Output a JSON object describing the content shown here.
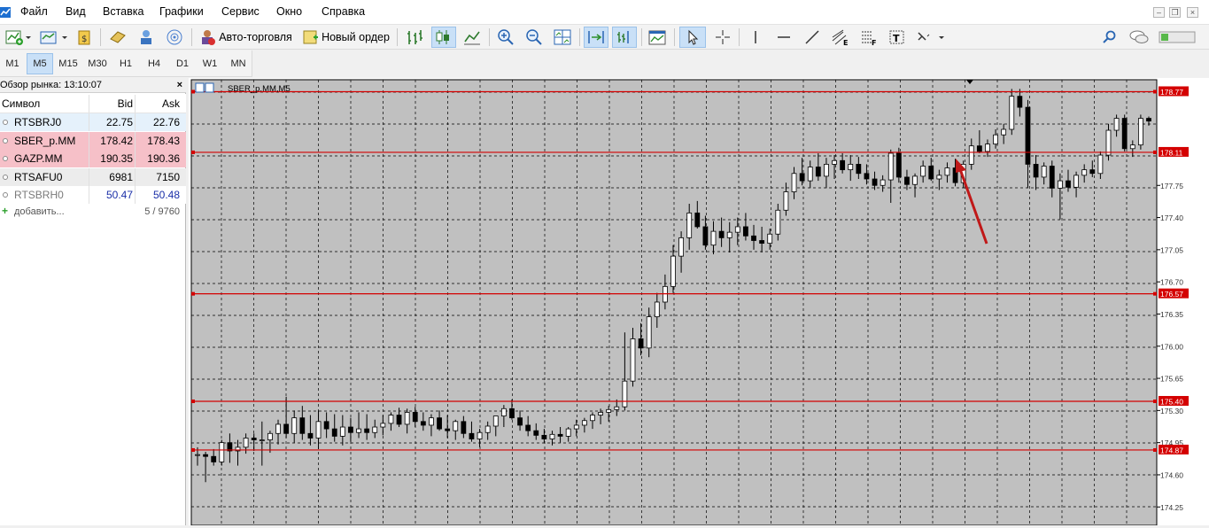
{
  "menu": [
    "Файл",
    "Вид",
    "Вставка",
    "Графики",
    "Сервис",
    "Окно",
    "Справка"
  ],
  "toolbar": {
    "auto_trading_label": "Авто-торговля",
    "new_order_label": "Новый ордер"
  },
  "timeframes": [
    "M1",
    "M5",
    "M15",
    "M30",
    "H1",
    "H4",
    "D1",
    "W1",
    "MN"
  ],
  "active_timeframe": "M5",
  "market_watch": {
    "title": "Обзор рынка: 13:10:07",
    "close_label": "×",
    "headers": {
      "symbol": "Символ",
      "bid": "Bid",
      "ask": "Ask"
    },
    "rows": [
      {
        "symbol": "RTSBRJ0",
        "bid": "22.75",
        "ask": "22.76",
        "bg": "#e5f1fb",
        "color": "#000000"
      },
      {
        "symbol": "SBER_p.MM",
        "bid": "178.42",
        "ask": "178.43",
        "bg": "#f6c0c8",
        "color": "#000000"
      },
      {
        "symbol": "GAZP.MM",
        "bid": "190.35",
        "ask": "190.36",
        "bg": "#f6c0c8",
        "color": "#000000"
      },
      {
        "symbol": "RTSAFU0",
        "bid": "6981",
        "ask": "7150",
        "bg": "#ececec",
        "color": "#000000"
      },
      {
        "symbol": "RTSBRH0",
        "bid": "50.47",
        "ask": "50.48",
        "bg": "#ffffff",
        "color": "#7a7a7a",
        "value_color": "#1a2fa8"
      }
    ],
    "add_label": "добавить...",
    "count_label": "5 / 9760"
  },
  "chart": {
    "title": "SBER_p.MM,M5",
    "y_ticks": [
      "178.77",
      "178.11",
      "177.75",
      "177.40",
      "177.05",
      "176.70",
      "176.57",
      "176.35",
      "176.00",
      "175.65",
      "175.40",
      "175.30",
      "174.95",
      "174.87",
      "174.60",
      "174.25"
    ],
    "highlighted_levels": [
      "178.77",
      "178.11",
      "176.57",
      "175.40",
      "174.87"
    ],
    "level_line_color": "#d40000",
    "background": "#c0c0c0"
  },
  "chart_data": {
    "type": "candlestick",
    "title": "SBER_p.MM,M5",
    "ylim": [
      174.05,
      178.9
    ],
    "horizontal_levels": [
      178.77,
      178.11,
      176.57,
      175.4,
      174.87
    ],
    "candles": [
      [
        174.82,
        174.9,
        174.7,
        174.82
      ],
      [
        174.82,
        174.85,
        174.52,
        174.8
      ],
      [
        174.8,
        174.88,
        174.7,
        174.74
      ],
      [
        174.74,
        174.98,
        174.7,
        174.95
      ],
      [
        174.95,
        175.05,
        174.73,
        174.86
      ],
      [
        174.86,
        174.98,
        174.7,
        174.9
      ],
      [
        174.9,
        175.05,
        174.83,
        175.0
      ],
      [
        175.0,
        175.05,
        174.86,
        174.98
      ],
      [
        174.98,
        175.18,
        174.7,
        174.98
      ],
      [
        174.98,
        175.08,
        174.84,
        175.05
      ],
      [
        175.05,
        175.2,
        174.93,
        175.15
      ],
      [
        175.15,
        175.45,
        175.0,
        175.05
      ],
      [
        175.05,
        175.3,
        174.95,
        175.22
      ],
      [
        175.22,
        175.35,
        174.98,
        175.05
      ],
      [
        175.05,
        175.25,
        174.92,
        175.0
      ],
      [
        175.0,
        175.3,
        174.88,
        175.18
      ],
      [
        175.18,
        175.28,
        175.0,
        175.1
      ],
      [
        175.1,
        175.26,
        174.96,
        175.02
      ],
      [
        175.02,
        175.25,
        174.92,
        175.12
      ],
      [
        175.12,
        175.22,
        174.96,
        175.06
      ],
      [
        175.06,
        175.28,
        175.0,
        175.1
      ],
      [
        175.1,
        175.26,
        174.98,
        175.06
      ],
      [
        175.06,
        175.2,
        175.0,
        175.12
      ],
      [
        175.12,
        175.25,
        175.03,
        175.16
      ],
      [
        175.16,
        175.28,
        175.08,
        175.25
      ],
      [
        175.25,
        175.33,
        175.12,
        175.15
      ],
      [
        175.15,
        175.32,
        175.05,
        175.28
      ],
      [
        175.28,
        175.34,
        175.12,
        175.18
      ],
      [
        175.18,
        175.28,
        175.08,
        175.14
      ],
      [
        175.14,
        175.26,
        175.02,
        175.22
      ],
      [
        175.22,
        175.3,
        175.08,
        175.1
      ],
      [
        175.1,
        175.25,
        175.0,
        175.08
      ],
      [
        175.08,
        175.2,
        174.98,
        175.18
      ],
      [
        175.18,
        175.24,
        175.0,
        175.05
      ],
      [
        175.05,
        175.18,
        174.96,
        174.99
      ],
      [
        174.99,
        175.1,
        174.9,
        175.06
      ],
      [
        175.06,
        175.18,
        174.98,
        175.13
      ],
      [
        175.13,
        175.2,
        175.02,
        175.24
      ],
      [
        175.24,
        175.36,
        175.12,
        175.32
      ],
      [
        175.32,
        175.42,
        175.2,
        175.22
      ],
      [
        175.22,
        175.3,
        175.08,
        175.14
      ],
      [
        175.14,
        175.24,
        175.02,
        175.08
      ],
      [
        175.08,
        175.16,
        174.98,
        175.03
      ],
      [
        175.03,
        175.1,
        174.95,
        174.99
      ],
      [
        174.99,
        175.08,
        174.92,
        175.04
      ],
      [
        175.04,
        175.12,
        174.95,
        175.02
      ],
      [
        175.02,
        175.12,
        174.96,
        175.1
      ],
      [
        175.1,
        175.2,
        175.02,
        175.14
      ],
      [
        175.14,
        175.22,
        175.06,
        175.19
      ],
      [
        175.19,
        175.28,
        175.1,
        175.25
      ],
      [
        175.25,
        175.32,
        175.15,
        175.28
      ],
      [
        175.28,
        175.35,
        175.18,
        175.31
      ],
      [
        175.31,
        175.42,
        175.24,
        175.34
      ],
      [
        175.34,
        176.15,
        175.3,
        175.62
      ],
      [
        175.62,
        176.2,
        175.56,
        176.08
      ],
      [
        176.08,
        176.25,
        175.9,
        175.98
      ],
      [
        175.98,
        176.42,
        175.88,
        176.32
      ],
      [
        176.32,
        176.58,
        176.2,
        176.48
      ],
      [
        176.48,
        176.78,
        176.4,
        176.65
      ],
      [
        176.65,
        177.1,
        176.58,
        176.98
      ],
      [
        176.98,
        177.25,
        176.8,
        177.18
      ],
      [
        177.18,
        177.55,
        177.05,
        177.45
      ],
      [
        177.45,
        177.58,
        177.28,
        177.3
      ],
      [
        177.3,
        177.42,
        177.05,
        177.1
      ],
      [
        177.1,
        177.36,
        177.0,
        177.25
      ],
      [
        177.25,
        177.4,
        177.08,
        177.18
      ],
      [
        177.18,
        177.35,
        177.02,
        177.24
      ],
      [
        177.24,
        177.4,
        177.1,
        177.3
      ],
      [
        177.3,
        177.45,
        177.15,
        177.2
      ],
      [
        177.2,
        177.32,
        177.05,
        177.15
      ],
      [
        177.15,
        177.3,
        177.02,
        177.12
      ],
      [
        177.12,
        177.28,
        177.05,
        177.22
      ],
      [
        177.22,
        177.55,
        177.15,
        177.48
      ],
      [
        177.48,
        177.78,
        177.42,
        177.68
      ],
      [
        177.68,
        177.95,
        177.6,
        177.88
      ],
      [
        177.88,
        178.05,
        177.75,
        177.8
      ],
      [
        177.8,
        178.02,
        177.72,
        177.95
      ],
      [
        177.95,
        178.1,
        177.8,
        177.85
      ],
      [
        177.85,
        178.05,
        177.72,
        177.98
      ],
      [
        177.98,
        178.08,
        177.82,
        178.02
      ],
      [
        178.02,
        178.1,
        177.88,
        177.92
      ],
      [
        177.92,
        178.08,
        177.8,
        177.98
      ],
      [
        177.98,
        178.06,
        177.82,
        177.88
      ],
      [
        177.88,
        177.98,
        177.76,
        177.82
      ],
      [
        177.82,
        177.9,
        177.7,
        177.75
      ],
      [
        177.75,
        177.86,
        177.68,
        177.81
      ],
      [
        177.81,
        178.14,
        177.56,
        178.1
      ],
      [
        178.1,
        178.16,
        177.78,
        177.84
      ],
      [
        177.84,
        177.92,
        177.7,
        177.76
      ],
      [
        177.76,
        177.88,
        177.62,
        177.85
      ],
      [
        177.85,
        178.02,
        177.78,
        177.96
      ],
      [
        177.96,
        178.05,
        177.8,
        177.82
      ],
      [
        177.82,
        177.92,
        177.7,
        177.86
      ],
      [
        177.86,
        178.0,
        177.78,
        177.94
      ],
      [
        177.94,
        178.04,
        177.74,
        177.78
      ],
      [
        177.78,
        178.02,
        177.72,
        177.98
      ],
      [
        177.98,
        178.26,
        177.92,
        178.18
      ],
      [
        178.18,
        178.35,
        178.1,
        178.12
      ],
      [
        178.12,
        178.25,
        178.06,
        178.2
      ],
      [
        178.2,
        178.36,
        178.15,
        178.3
      ],
      [
        178.3,
        178.42,
        178.2,
        178.36
      ],
      [
        178.36,
        178.8,
        178.3,
        178.72
      ],
      [
        178.72,
        178.8,
        178.5,
        178.6
      ],
      [
        178.6,
        178.68,
        177.72,
        177.98
      ],
      [
        177.98,
        178.08,
        177.7,
        177.84
      ],
      [
        177.84,
        178.0,
        177.76,
        177.96
      ],
      [
        177.96,
        178.02,
        177.62,
        177.72
      ],
      [
        177.72,
        177.88,
        177.38,
        177.8
      ],
      [
        177.8,
        177.92,
        177.68,
        177.73
      ],
      [
        177.73,
        177.9,
        177.62,
        177.86
      ],
      [
        177.86,
        177.98,
        177.78,
        177.92
      ],
      [
        177.92,
        178.02,
        177.84,
        177.88
      ],
      [
        177.88,
        178.12,
        177.82,
        178.08
      ],
      [
        178.08,
        178.42,
        178.02,
        178.35
      ],
      [
        178.35,
        178.52,
        178.28,
        178.48
      ],
      [
        178.48,
        178.52,
        178.12,
        178.15
      ],
      [
        178.15,
        178.24,
        178.06,
        178.19
      ],
      [
        178.19,
        178.52,
        178.14,
        178.48
      ],
      [
        178.48,
        178.5,
        178.4,
        178.45
      ]
    ]
  }
}
